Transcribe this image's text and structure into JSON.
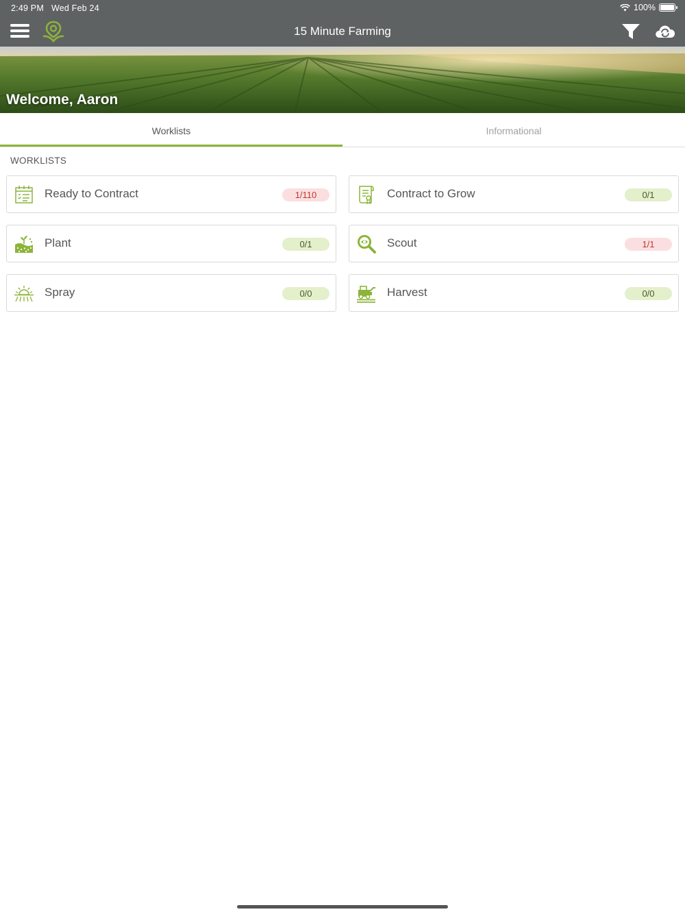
{
  "status_bar": {
    "time": "2:49 PM",
    "date": "Wed Feb 24",
    "battery": "100%"
  },
  "header": {
    "title": "15 Minute Farming"
  },
  "hero": {
    "welcome": "Welcome, Aaron"
  },
  "tabs": [
    {
      "label": "Worklists",
      "active": true
    },
    {
      "label": "Informational",
      "active": false
    }
  ],
  "worklists": {
    "section_title": "WORKLISTS",
    "items": [
      {
        "label": "Ready to Contract",
        "count": "1/110",
        "status": "red",
        "icon": "calendar-list-icon"
      },
      {
        "label": "Contract to Grow",
        "count": "0/1",
        "status": "green",
        "icon": "contract-document-icon"
      },
      {
        "label": "Plant",
        "count": "0/1",
        "status": "green",
        "icon": "plant-seedling-icon"
      },
      {
        "label": "Scout",
        "count": "1/1",
        "status": "red",
        "icon": "scout-magnifier-icon"
      },
      {
        "label": "Spray",
        "count": "0/0",
        "status": "green",
        "icon": "spray-icon"
      },
      {
        "label": "Harvest",
        "count": "0/0",
        "status": "green",
        "icon": "harvester-icon"
      }
    ]
  },
  "colors": {
    "brand_green": "#8cb43a",
    "header_gray": "#5f6263",
    "badge_red_bg": "#fbdfe0",
    "badge_green_bg": "#e4efcb"
  }
}
